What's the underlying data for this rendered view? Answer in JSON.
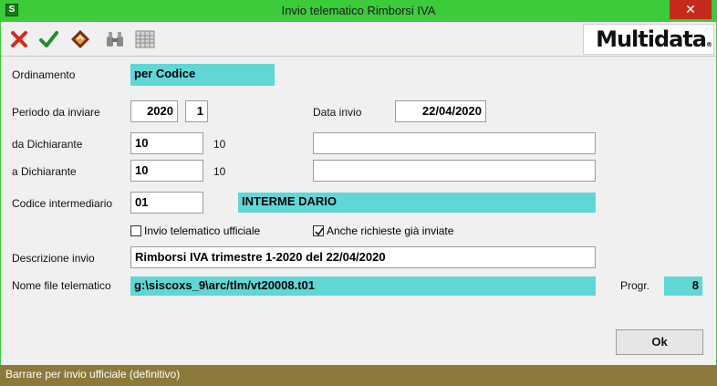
{
  "window": {
    "title": "Invio telematico Rimborsi IVA",
    "close_glyph": "✕"
  },
  "toolbar": {
    "buttons": [
      {
        "name": "cancel-icon",
        "color": "#d42a1e"
      },
      {
        "name": "confirm-icon",
        "color": "#1f8f2a"
      },
      {
        "name": "book-icon",
        "color": "#7a2a10"
      },
      {
        "name": "binoculars-icon",
        "color": "#8a8a8a"
      },
      {
        "name": "calendar-grid-icon",
        "color": "#8a8a8a"
      }
    ],
    "brand": "Multidata",
    "brand_mark": "®"
  },
  "form": {
    "ordinamento": {
      "label": "Ordinamento",
      "value": "per Codice"
    },
    "periodo": {
      "label": "Periodo da inviare",
      "year": "2020",
      "period": "1"
    },
    "data_invio": {
      "label": "Data invio",
      "value": "22/04/2020"
    },
    "da_dichiarante": {
      "label": "da Dichiarante",
      "value": "10",
      "hint": "10",
      "name": ""
    },
    "a_dichiarante": {
      "label": "a Dichiarante",
      "value": "10",
      "hint": "10",
      "name": ""
    },
    "intermediario": {
      "label": "Codice intermediario",
      "code": "01",
      "name": "INTERME DARIO"
    },
    "checkbox_ufficiale": {
      "label": "Invio telematico ufficiale",
      "checked": false
    },
    "checkbox_gia_inviate": {
      "label": "Anche richieste già inviate",
      "checked": true
    },
    "descrizione": {
      "label": "Descrizione invio",
      "value": "Rimborsi IVA trimestre 1-2020 del 22/04/2020"
    },
    "nome_file": {
      "label": "Nome file telematico",
      "value": "g:\\siscoxs_9\\arc/tlm/vt20008.t01"
    },
    "progr": {
      "label": "Progr.",
      "value": "8"
    }
  },
  "ok_label": "Ok",
  "status_text": "Barrare per invio ufficiale (definitivo)",
  "colors": {
    "title_bar": "#3bcb3b",
    "cyan_field": "#5fd7d7",
    "status_bar": "#8b7a3a"
  }
}
